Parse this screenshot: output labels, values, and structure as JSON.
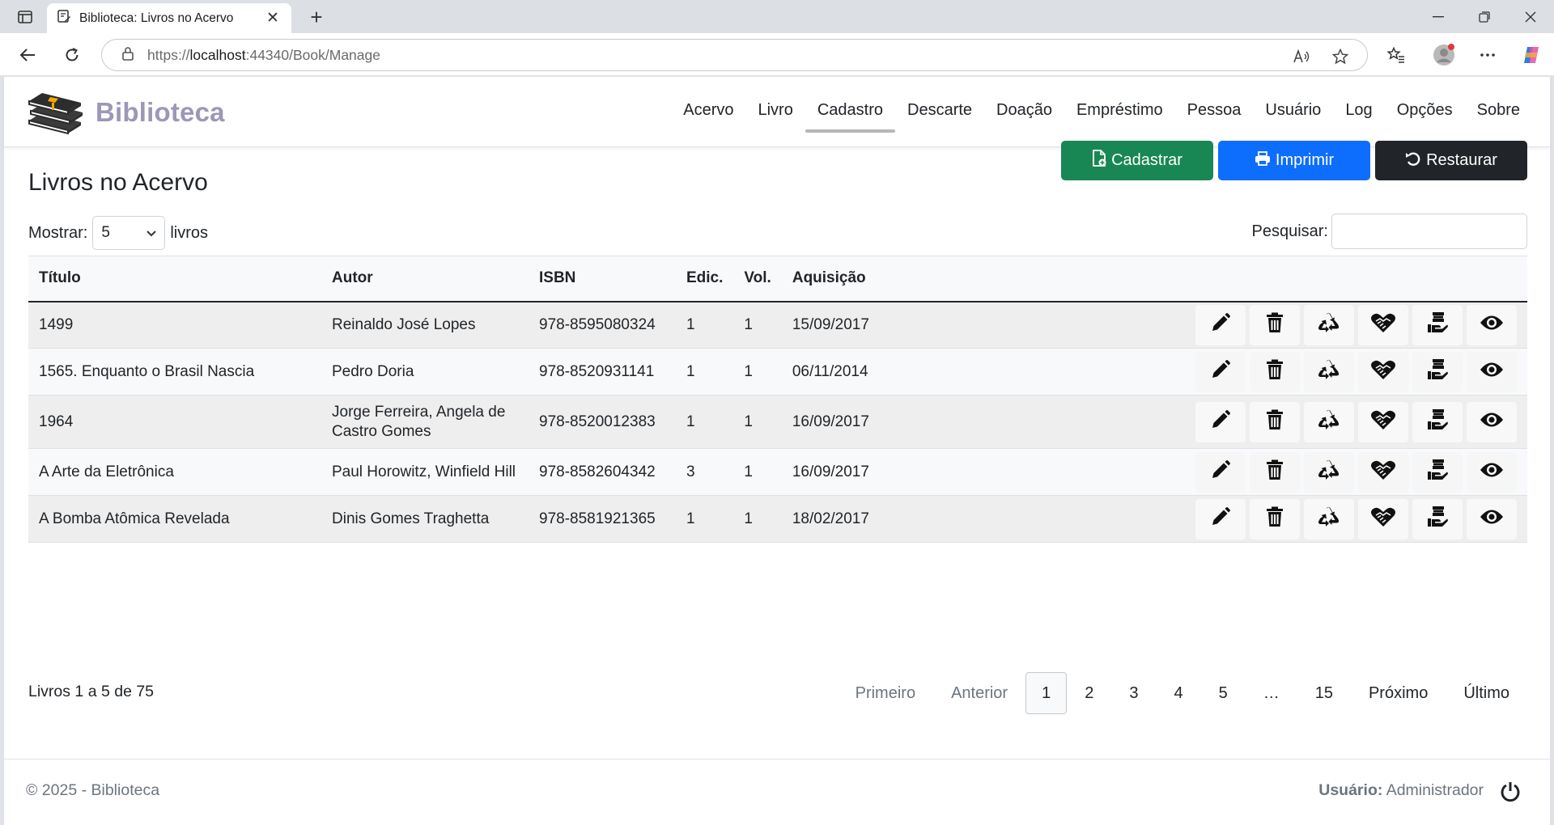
{
  "browser": {
    "tab_title": "Biblioteca: Livros no Acervo",
    "url_scheme": "https://",
    "url_host": "localhost",
    "url_rest": ":44340/Book/Manage"
  },
  "site": {
    "brand": "Biblioteca",
    "nav": [
      "Acervo",
      "Livro",
      "Cadastro",
      "Descarte",
      "Doação",
      "Empréstimo",
      "Pessoa",
      "Usuário",
      "Log",
      "Opções",
      "Sobre"
    ],
    "active_nav": "Cadastro"
  },
  "page": {
    "title": "Livros no Acervo",
    "buttons": {
      "register": "Cadastrar",
      "print": "Imprimir",
      "restore": "Restaurar"
    },
    "length": {
      "prefix": "Mostrar:",
      "value": "5",
      "suffix": "livros"
    },
    "search": {
      "label": "Pesquisar:",
      "value": ""
    }
  },
  "table": {
    "headers": [
      "Título",
      "Autor",
      "ISBN",
      "Edic.",
      "Vol.",
      "Aquisição"
    ],
    "rows": [
      {
        "titulo": "1499",
        "autor": "Reinaldo José Lopes",
        "isbn": "978-8595080324",
        "edic": "1",
        "vol": "1",
        "aquisicao": "15/09/2017"
      },
      {
        "titulo": "1565. Enquanto o Brasil Nascia",
        "autor": "Pedro Doria",
        "isbn": "978-8520931141",
        "edic": "1",
        "vol": "1",
        "aquisicao": "06/11/2014"
      },
      {
        "titulo": "1964",
        "autor": "Jorge Ferreira, Angela de Castro Gomes",
        "isbn": "978-8520012383",
        "edic": "1",
        "vol": "1",
        "aquisicao": "16/09/2017"
      },
      {
        "titulo": "A Arte da Eletrônica",
        "autor": "Paul Horowitz, Winfield Hill",
        "isbn": "978-8582604342",
        "edic": "3",
        "vol": "1",
        "aquisicao": "16/09/2017"
      },
      {
        "titulo": "A Bomba Atômica Revelada",
        "autor": "Dinis Gomes Traghetta",
        "isbn": "978-8581921365",
        "edic": "1",
        "vol": "1",
        "aquisicao": "18/02/2017"
      }
    ],
    "row_actions": [
      "edit-icon",
      "trash-icon",
      "recycle-icon",
      "handshake-heart-icon",
      "hand-holding-book-icon",
      "eye-icon"
    ]
  },
  "pagination": {
    "info": "Livros 1 a 5 de 75",
    "first": "Primeiro",
    "previous": "Anterior",
    "pages": [
      "1",
      "2",
      "3",
      "4",
      "5",
      "…",
      "15"
    ],
    "current": "1",
    "next": "Próximo",
    "last": "Último"
  },
  "footer": {
    "copyright": "© 2025 - Biblioteca",
    "user_label": "Usuário:",
    "user_name": "Administrador"
  },
  "colors": {
    "brand": "#9b97b8",
    "success": "#198754",
    "primary": "#0d6efd",
    "dark": "#212529"
  }
}
